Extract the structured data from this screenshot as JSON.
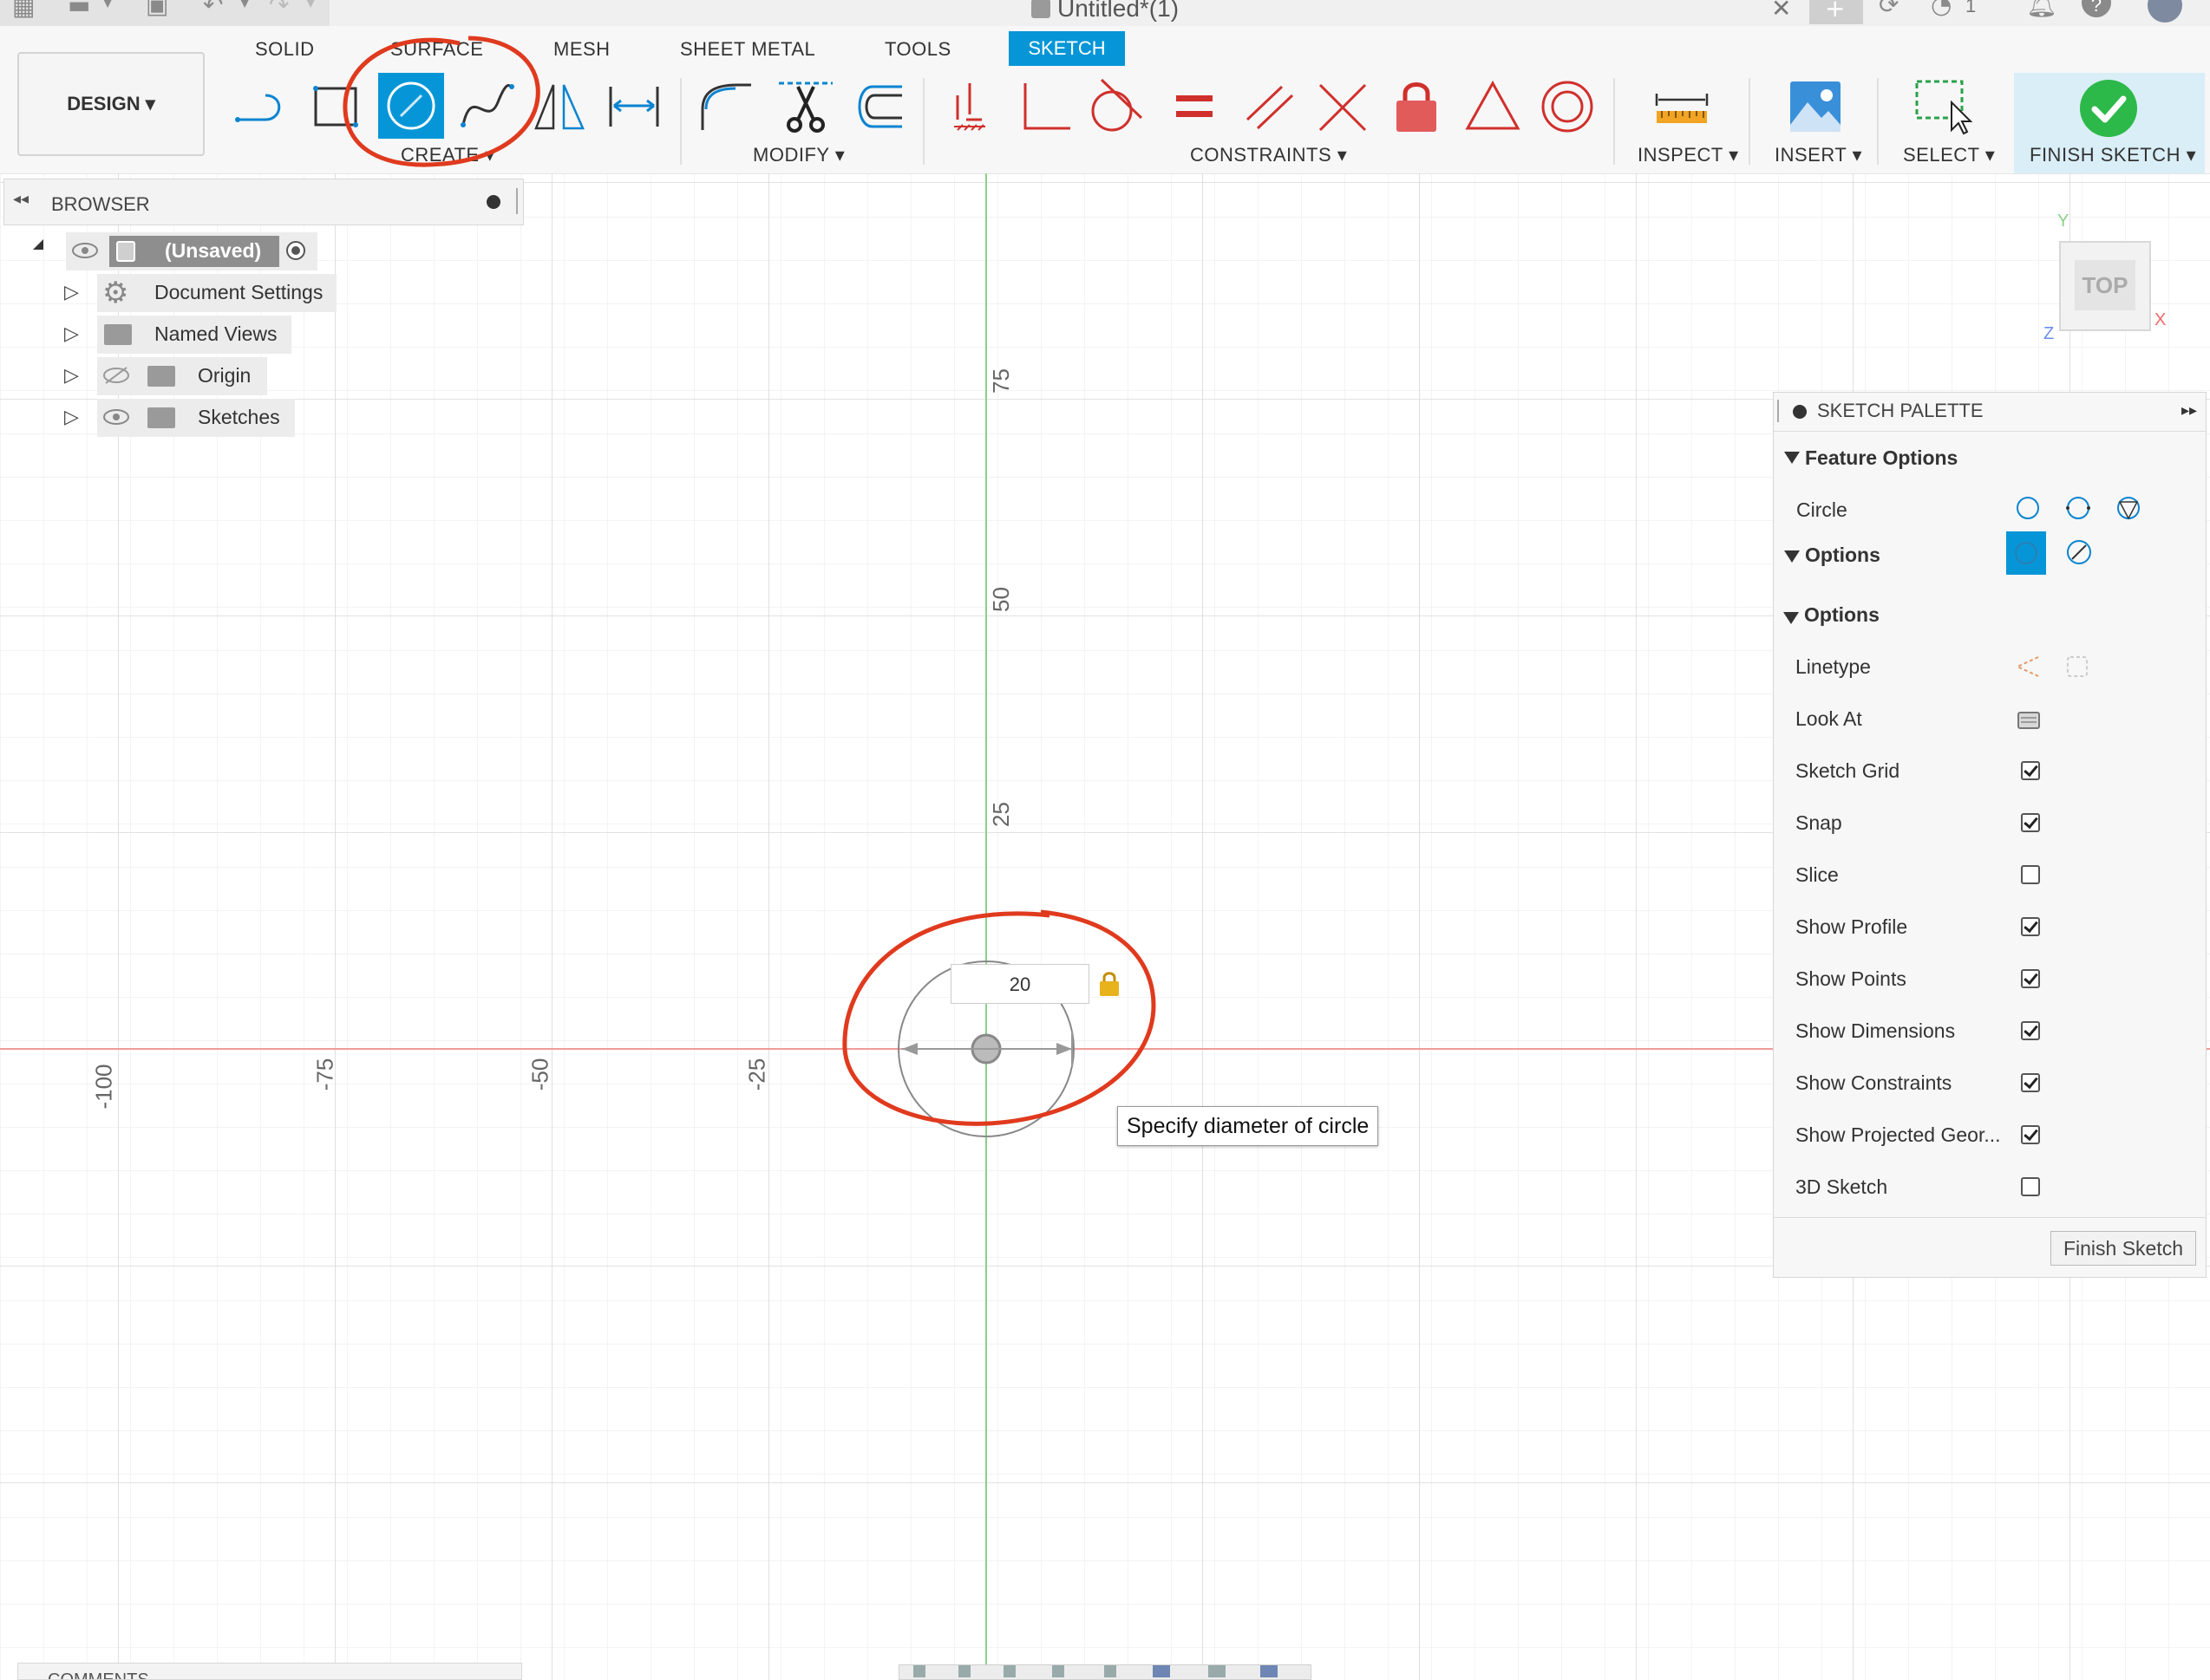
{
  "window": {
    "title": "Untitled*(1)",
    "jobs_count": "1"
  },
  "toolbar": {
    "workspace_button": "DESIGN ▾",
    "tabs": [
      "SOLID",
      "SURFACE",
      "MESH",
      "SHEET METAL",
      "TOOLS",
      "SKETCH"
    ],
    "active_tab": "SKETCH",
    "groups": {
      "create": "CREATE ▾",
      "modify": "MODIFY ▾",
      "constraints": "CONSTRAINTS ▾",
      "inspect": "INSPECT ▾",
      "insert": "INSERT ▾",
      "select": "SELECT ▾",
      "finish": "FINISH SKETCH ▾"
    },
    "accent_color": "#0696d7",
    "annotation_color": "#e03a1e"
  },
  "browser": {
    "title": "BROWSER",
    "root": "(Unsaved)",
    "items": [
      "Document Settings",
      "Named Views",
      "Origin",
      "Sketches"
    ]
  },
  "viewcube": {
    "face": "TOP",
    "axis_y": "Y",
    "axis_x": "X",
    "axis_z": "Z"
  },
  "canvas": {
    "y_ticks": [
      "75",
      "50",
      "25"
    ],
    "x_ticks": [
      "-100",
      "-75",
      "-50",
      "-25"
    ],
    "dimension_value": "20",
    "tooltip": "Specify diameter of circle"
  },
  "palette": {
    "title": "SKETCH PALETTE",
    "feature_options_title": "Feature Options",
    "circle_label": "Circle",
    "options_title": "Options",
    "linetype_label": "Linetype",
    "look_at_label": "Look At",
    "options": [
      {
        "label": "Sketch Grid",
        "checked": true
      },
      {
        "label": "Snap",
        "checked": true
      },
      {
        "label": "Slice",
        "checked": false
      },
      {
        "label": "Show Profile",
        "checked": true
      },
      {
        "label": "Show Points",
        "checked": true
      },
      {
        "label": "Show Dimensions",
        "checked": true
      },
      {
        "label": "Show Constraints",
        "checked": true
      },
      {
        "label": "Show Projected Geor...",
        "checked": true
      },
      {
        "label": "3D Sketch",
        "checked": false
      }
    ],
    "finish_button": "Finish Sketch"
  },
  "comments": {
    "title": "COMMENTS"
  }
}
